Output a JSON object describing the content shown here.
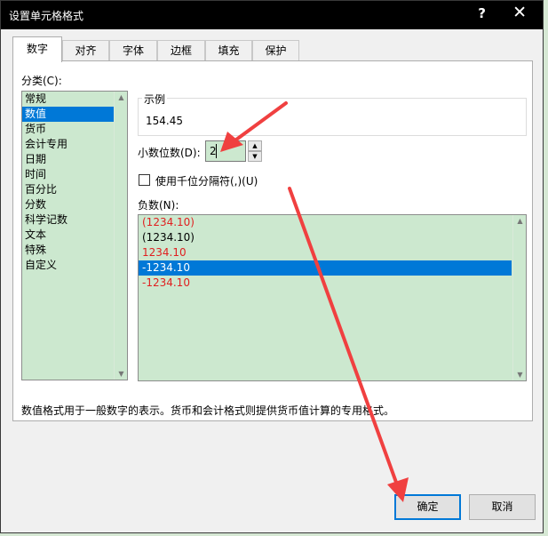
{
  "dialog": {
    "title": "设置单元格格式",
    "help_label": "?",
    "close_label": "✕"
  },
  "tabs": [
    {
      "label": "数字",
      "active": true
    },
    {
      "label": "对齐"
    },
    {
      "label": "字体"
    },
    {
      "label": "边框"
    },
    {
      "label": "填充"
    },
    {
      "label": "保护"
    }
  ],
  "category": {
    "label": "分类(C):",
    "items": [
      "常规",
      "数值",
      "货币",
      "会计专用",
      "日期",
      "时间",
      "百分比",
      "分数",
      "科学记数",
      "文本",
      "特殊",
      "自定义"
    ],
    "selected": "数值"
  },
  "sample": {
    "legend": "示例",
    "value": "154.45"
  },
  "decimal": {
    "label": "小数位数(D):",
    "value": "2"
  },
  "thousands": {
    "label": "使用千位分隔符(,)(U)",
    "checked": false
  },
  "negative": {
    "label": "负数(N):",
    "items": [
      {
        "text": "(1234.10)",
        "color": "red"
      },
      {
        "text": "(1234.10)",
        "color": "black"
      },
      {
        "text": "1234.10",
        "color": "red"
      },
      {
        "text": "-1234.10",
        "color": "black",
        "selected": true
      },
      {
        "text": "-1234.10",
        "color": "red"
      }
    ]
  },
  "description": "数值格式用于一般数字的表示。货币和会计格式则提供货币值计算的专用格式。",
  "buttons": {
    "ok": "确定",
    "cancel": "取消"
  },
  "background": {
    "frag_top": "4",
    "frag_rows": [
      "0",
      "0",
      "0"
    ]
  },
  "colors": {
    "list_bg": "#cce8cf",
    "selection": "#0078d7",
    "negative_red": "#e02020",
    "annotation_arrow": "#f04040"
  }
}
